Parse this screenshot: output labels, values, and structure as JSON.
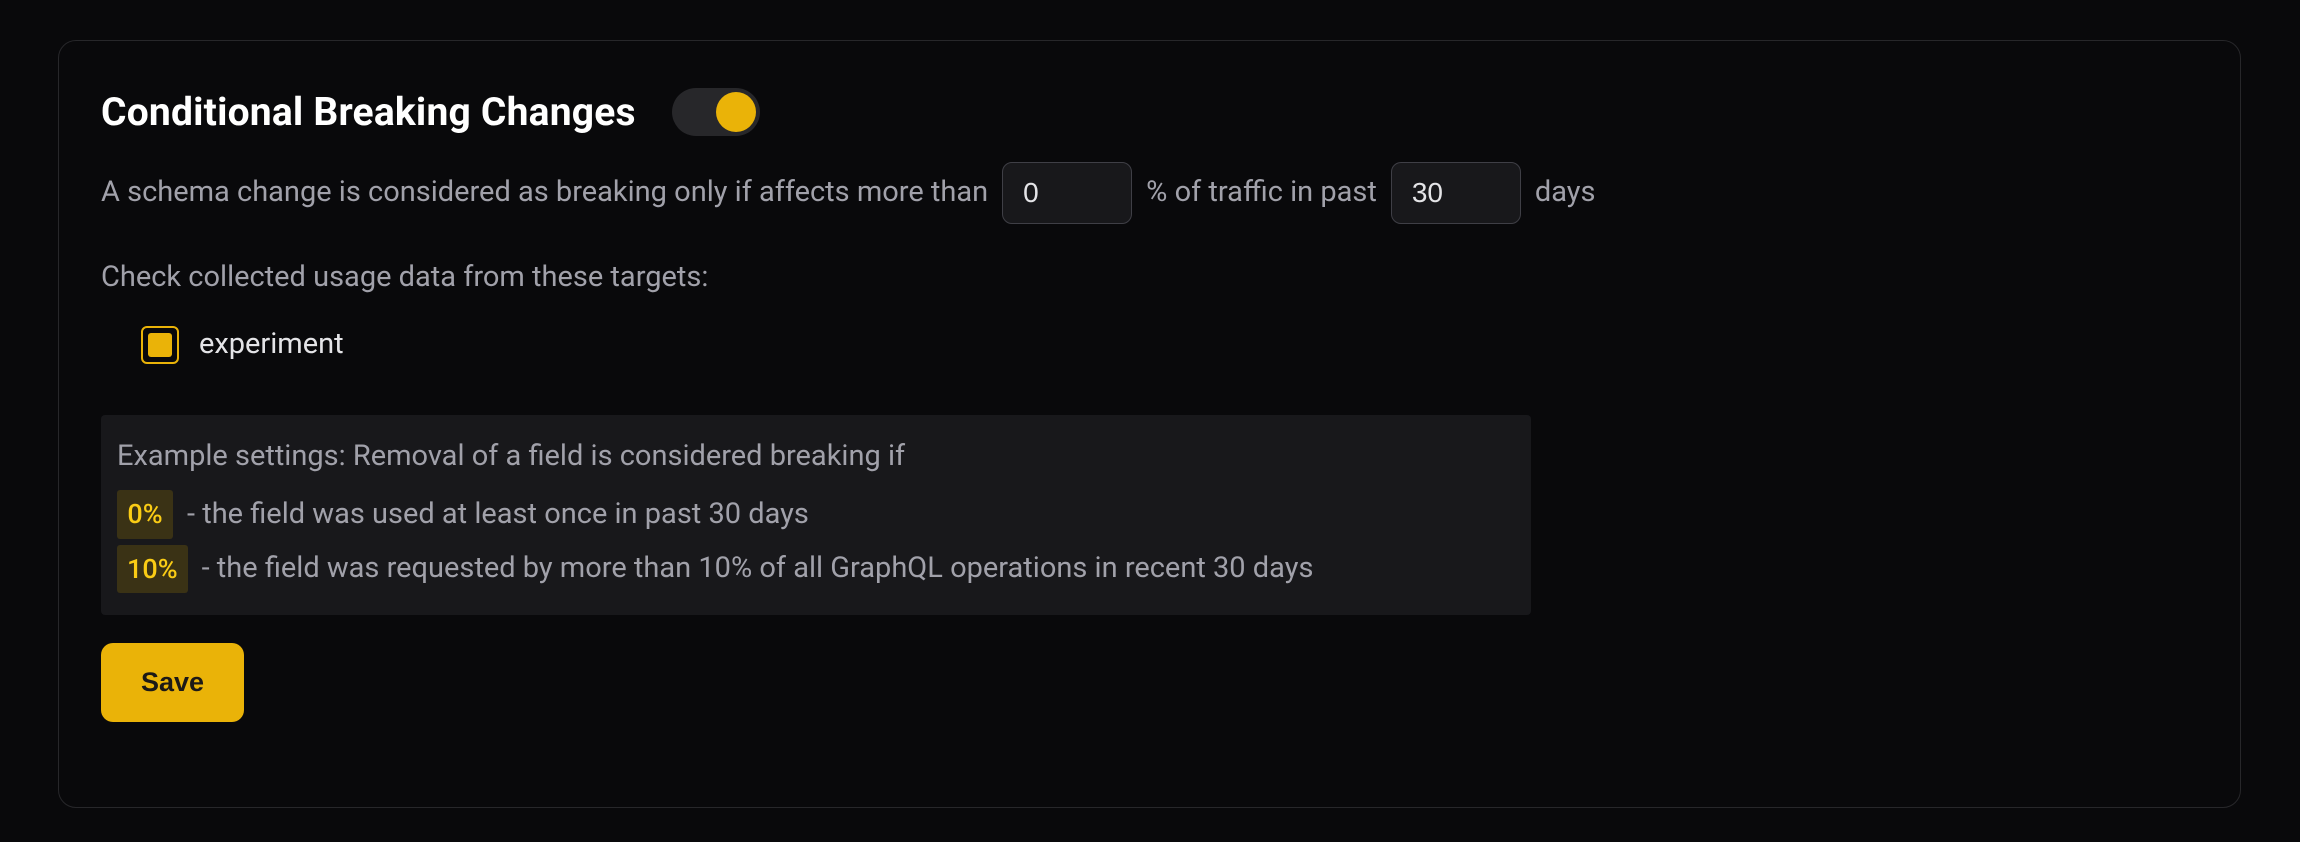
{
  "header": {
    "title": "Conditional Breaking Changes",
    "toggle_on": true
  },
  "threshold": {
    "prefix": "A schema change is considered as breaking only if affects more than",
    "percent_value": "0",
    "mid": "% of traffic in past",
    "days_value": "30",
    "suffix": "days"
  },
  "targets": {
    "label": "Check collected usage data from these targets:",
    "items": [
      {
        "name": "experiment",
        "checked": true
      }
    ]
  },
  "example": {
    "intro": "Example settings: Removal of a field is considered breaking if",
    "rows": [
      {
        "badge": "0%",
        "text": "- the field was used at least once in past 30 days"
      },
      {
        "badge": "10%",
        "text": "- the field was requested by more than 10% of all GraphQL operations in recent 30 days"
      }
    ]
  },
  "actions": {
    "save_label": "Save"
  }
}
